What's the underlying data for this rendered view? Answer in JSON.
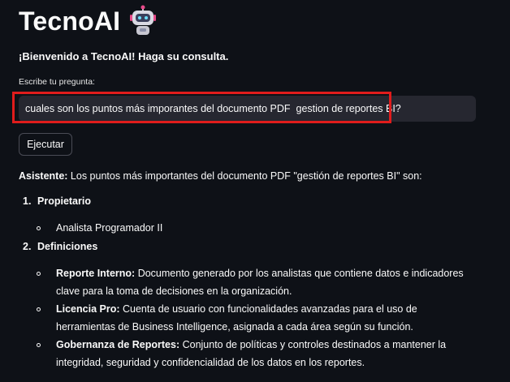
{
  "app": {
    "title": "TecnoAI",
    "welcome": "¡Bienvenido a TecnoAI! Haga su consulta.",
    "question_label": "Escribe tu pregunta:",
    "question_value": "cuales son los puntos más imporantes del documento PDF  gestion de reportes BI?",
    "run_button": "Ejecutar",
    "accent_highlight": "#e01c1c",
    "logo_icon": "robot-icon"
  },
  "answer": {
    "speaker": "Asistente:",
    "intro": " Los puntos más importantes del documento PDF \"gestión de reportes BI\" son:",
    "sections": [
      {
        "number": "1.",
        "title": "Propietario",
        "items": [
          {
            "term": "",
            "text": "Analista Programador II"
          }
        ]
      },
      {
        "number": "2.",
        "title": "Definiciones",
        "items": [
          {
            "term": "Reporte Interno:",
            "text": " Documento generado por los analistas que contiene datos e indicadores clave para la toma de decisiones en la organización."
          },
          {
            "term": "Licencia Pro:",
            "text": " Cuenta de usuario con funcionalidades avanzadas para el uso de herramientas de Business Intelligence, asignada a cada área según su función."
          },
          {
            "term": "Gobernanza de Reportes:",
            "text": " Conjunto de políticas y controles destinados a mantener la integridad, seguridad y confidencialidad de los datos en los reportes."
          }
        ]
      }
    ]
  }
}
